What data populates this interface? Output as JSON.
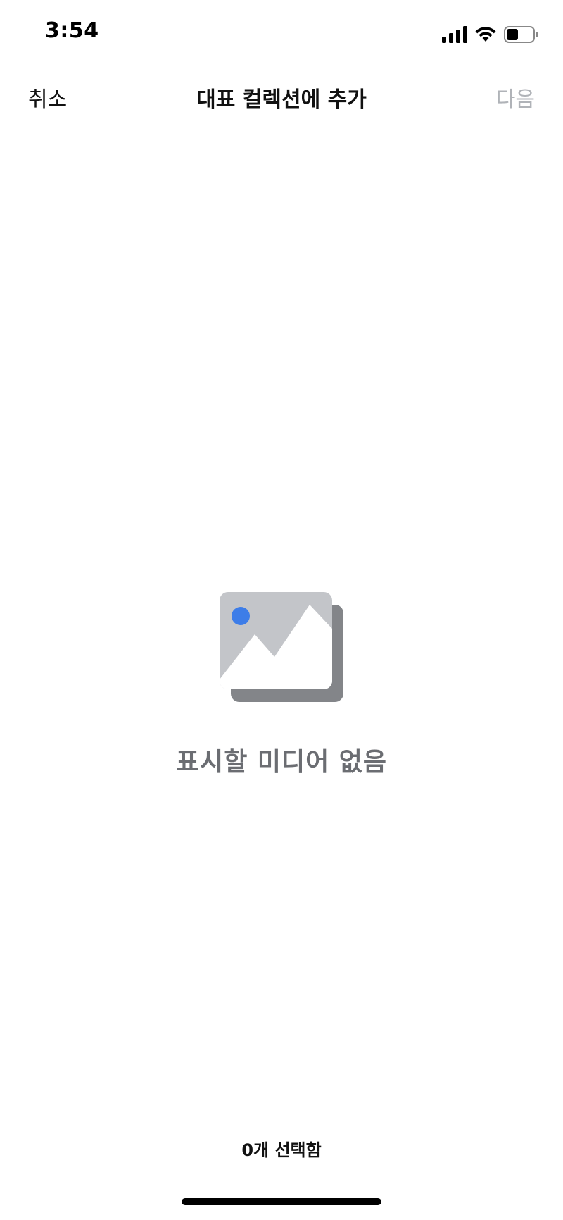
{
  "status_bar": {
    "time": "3:54",
    "icons": [
      "signal-icon",
      "wifi-icon",
      "battery-icon"
    ],
    "battery_level": 0.45
  },
  "header": {
    "cancel_label": "취소",
    "title": "대표 컬렉션에 추가",
    "next_label": "다음"
  },
  "empty_state": {
    "icon": "no-media-icon",
    "message": "표시할 미디어 없음"
  },
  "footer": {
    "selected_text": "0개 선택함"
  },
  "colors": {
    "accent_blue": "#3d7de8",
    "disabled_text": "#b0b3b8",
    "empty_text": "#6b6d72",
    "image_front": "#c3c5c9",
    "image_back": "#838589"
  }
}
